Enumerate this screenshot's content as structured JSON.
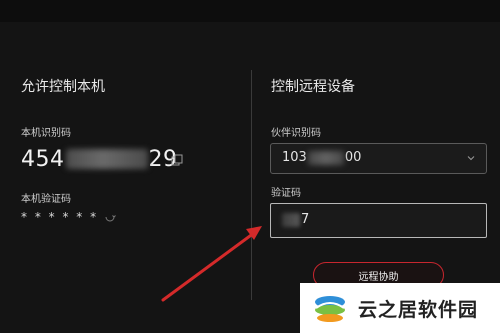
{
  "left": {
    "title": "允许控制本机",
    "id_label": "本机识别码",
    "id_prefix": "454",
    "id_suffix": "29",
    "password_label": "本机验证码",
    "password_value": "* * * * * *"
  },
  "right": {
    "title": "控制远程设备",
    "partner_label": "伙伴识别码",
    "partner_prefix": "103",
    "partner_suffix": "00",
    "code_label": "验证码",
    "code_suffix": "7",
    "connect_label": "远程协助"
  },
  "watermark": {
    "text": "云之居软件园"
  },
  "colors": {
    "background": "#141414",
    "accent_red": "#c8262e",
    "text": "#e6e6e6"
  },
  "icons": [
    "copy-icon",
    "refresh-icon",
    "chevron-down-icon",
    "red-arrow"
  ]
}
